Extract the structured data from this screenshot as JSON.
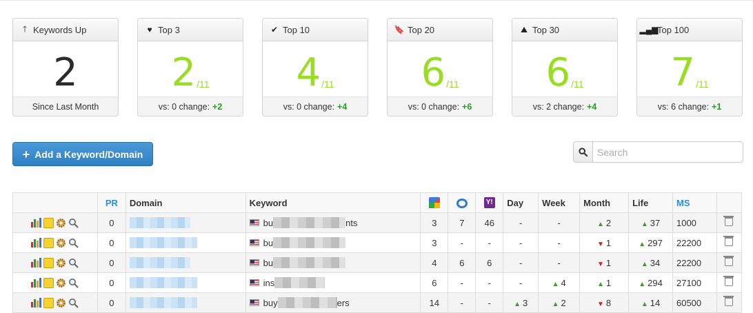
{
  "cards": [
    {
      "icon": "arrow-up-icon",
      "glyph": "🡑",
      "title": "Keywords Up",
      "value": "2",
      "of": "",
      "footer": "Since Last Month",
      "change": ""
    },
    {
      "icon": "heart-icon",
      "glyph": "♥",
      "title": "Top 3",
      "value": "2",
      "of": "/11",
      "footer": "vs: 0 change:",
      "change": "+2"
    },
    {
      "icon": "check-icon",
      "glyph": "✔",
      "title": "Top 10",
      "value": "4",
      "of": "/11",
      "footer": "vs: 0 change:",
      "change": "+4"
    },
    {
      "icon": "bookmark-icon",
      "glyph": "🔖",
      "title": "Top 20",
      "value": "6",
      "of": "/11",
      "footer": "vs: 0 change:",
      "change": "+6"
    },
    {
      "icon": "road-icon",
      "glyph": "⛰",
      "title": "Top 30",
      "value": "6",
      "of": "/11",
      "footer": "vs: 2 change:",
      "change": "+4"
    },
    {
      "icon": "signal-icon",
      "glyph": "▂▄▆",
      "title": "Top 100",
      "value": "7",
      "of": "/11",
      "footer": "vs: 6 change:",
      "change": "+1"
    }
  ],
  "add_button": {
    "label": "Add a Keyword/Domain",
    "icon": "plus-icon"
  },
  "search": {
    "placeholder": "Search",
    "icon": "search-icon"
  },
  "table": {
    "headers": {
      "pr": "PR",
      "domain": "Domain",
      "keyword": "Keyword",
      "day": "Day",
      "week": "Week",
      "month": "Month",
      "life": "Life",
      "ms": "MS"
    },
    "engine_icons": [
      "google-icon",
      "bing-icon",
      "yahoo-icon"
    ],
    "rows": [
      {
        "pr": "0",
        "kw_start": "bu",
        "kw_end": "nts",
        "google": "3",
        "bing": "7",
        "yahoo": "46",
        "day": "-",
        "day_dir": "",
        "week": "-",
        "week_dir": "",
        "month": "2",
        "month_dir": "up",
        "life": "37",
        "life_dir": "up",
        "ms": "1000"
      },
      {
        "pr": "0",
        "kw_start": "bu",
        "kw_end": "",
        "google": "3",
        "bing": "-",
        "yahoo": "-",
        "day": "-",
        "day_dir": "",
        "week": "-",
        "week_dir": "",
        "month": "1",
        "month_dir": "down",
        "life": "297",
        "life_dir": "up",
        "ms": "22200"
      },
      {
        "pr": "0",
        "kw_start": "bu",
        "kw_end": "",
        "google": "4",
        "bing": "6",
        "yahoo": "6",
        "day": "-",
        "day_dir": "",
        "week": "-",
        "week_dir": "",
        "month": "1",
        "month_dir": "down",
        "life": "34",
        "life_dir": "up",
        "ms": "22200"
      },
      {
        "pr": "0",
        "kw_start": "ins",
        "kw_end": "",
        "google": "6",
        "bing": "-",
        "yahoo": "-",
        "day": "-",
        "day_dir": "",
        "week": "4",
        "week_dir": "up",
        "month": "1",
        "month_dir": "up",
        "life": "294",
        "life_dir": "up",
        "ms": "27100"
      },
      {
        "pr": "0",
        "kw_start": "buy",
        "kw_end": "ers",
        "google": "14",
        "bing": "-",
        "yahoo": "-",
        "day": "3",
        "day_dir": "up",
        "week": "2",
        "week_dir": "up",
        "month": "8",
        "month_dir": "down",
        "life": "14",
        "life_dir": "up",
        "ms": "60500"
      }
    ]
  }
}
